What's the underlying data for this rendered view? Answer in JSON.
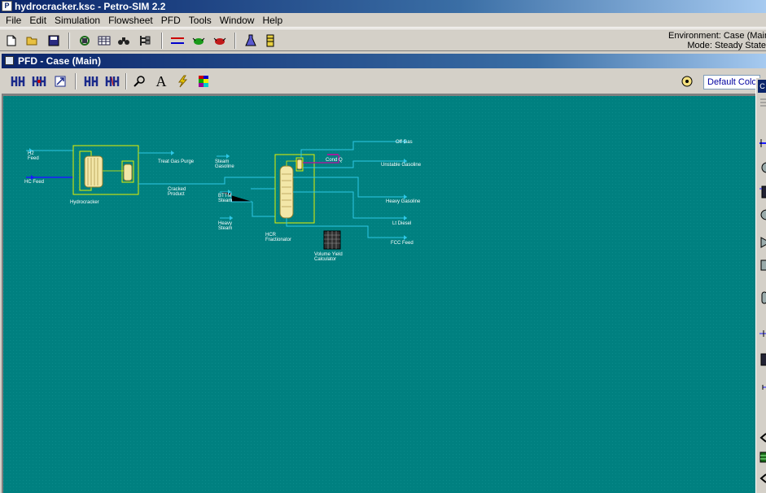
{
  "window": {
    "title": "hydrocracker.ksc - Petro-SIM 2.2"
  },
  "menu": [
    "File",
    "Edit",
    "Simulation",
    "Flowsheet",
    "PFD",
    "Tools",
    "Window",
    "Help"
  ],
  "toolbar": {
    "environment_text": "Environment: Case (Main)",
    "mode_text": "Mode: Steady State"
  },
  "pfd_window": {
    "title": "PFD - Case (Main)",
    "color_scheme": "Default Colour Scheme"
  },
  "flowsheet": {
    "streams": {
      "h2_feed": "H2\nFeed",
      "hc_feed": "HC Feed",
      "treat_gas_purge": "Treat Gas Purge",
      "cracked_product": "Cracked\nProduct",
      "steam_gasoline": "Steam\nGasoline",
      "bttm_steam": "BTTM\nSteam",
      "heavy_steam": "Heavy\nSteam",
      "off_gas": "Off Gas",
      "cond_q": "Cond Q",
      "unstable_gasoline": "Unstable Gasoline",
      "heavy_gasoline": "Heavy Gasoline",
      "lt_diesel": "Lt Diesel",
      "fcc_feed": "FCC Feed"
    },
    "units": {
      "hydrocracker": "Hydrocracker",
      "hcr_fractionator": "HCR\nFractionator",
      "volume_yield_calculator": "Volume Yield\nCalculator"
    }
  },
  "colors": {
    "canvas": "#008080",
    "stream_line": "#2ec7e6",
    "stream_feed": "#1a1aff",
    "energy_stream": "#a0209a",
    "unit_border": "#e8f000",
    "vessel": "#f3e7a8"
  }
}
